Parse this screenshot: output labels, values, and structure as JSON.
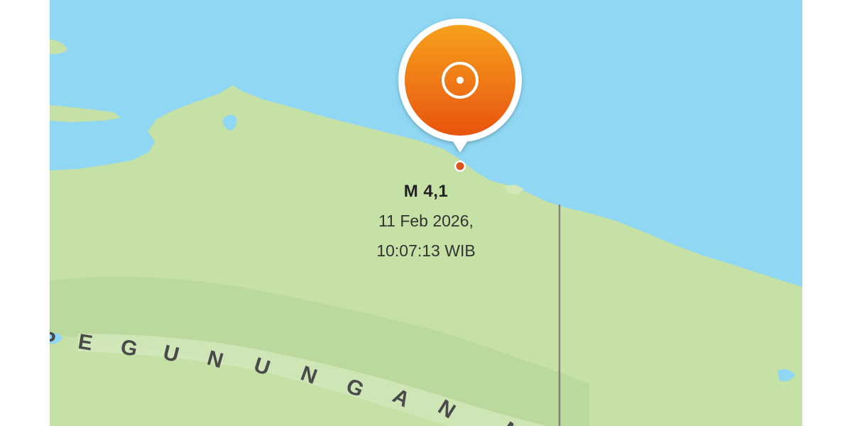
{
  "map": {
    "colors": {
      "sea": "#8fd7f3",
      "land": "#c5e1a5",
      "marker_top": "#f7a11c",
      "marker_bottom": "#e8540f",
      "border": "#8a7f80"
    },
    "region_label": "PEGUNUNGAN M"
  },
  "earthquake": {
    "magnitude_label": "M 4,1",
    "date_line": "11 Feb 2026,",
    "time_line": "10:07:13 WIB",
    "icon": "epicenter-icon"
  }
}
